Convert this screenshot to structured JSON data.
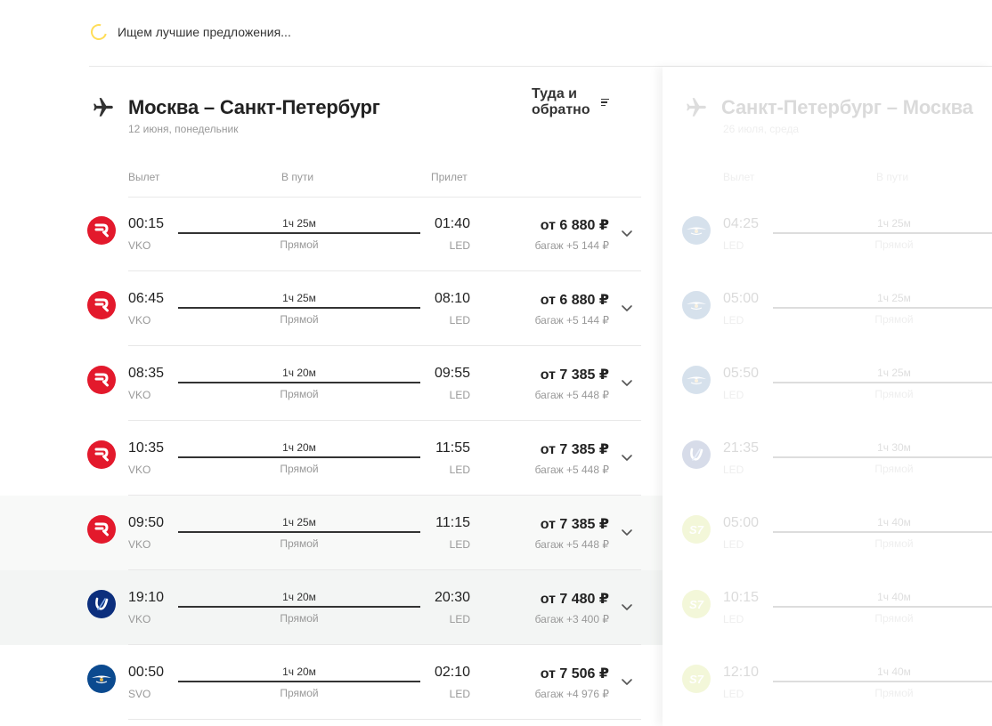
{
  "status": {
    "text": "Ищем лучшие предложения..."
  },
  "outbound": {
    "title": "Москва – Санкт-Петербург",
    "date": "12 июня, понедельник",
    "columns": {
      "departure": "Вылет",
      "duration": "В пути",
      "arrival": "Прилет",
      "price": "Туда и обратно"
    },
    "flights": [
      {
        "airline": "rossiya",
        "dep_time": "00:15",
        "dep_code": "VKO",
        "duration": "1ч 25м",
        "kind": "Прямой",
        "arr_time": "01:40",
        "arr_code": "LED",
        "price": "от 6 880 ₽",
        "baggage": "багаж +5 144 ₽"
      },
      {
        "airline": "rossiya",
        "dep_time": "06:45",
        "dep_code": "VKO",
        "duration": "1ч 25м",
        "kind": "Прямой",
        "arr_time": "08:10",
        "arr_code": "LED",
        "price": "от 6 880 ₽",
        "baggage": "багаж +5 144 ₽"
      },
      {
        "airline": "rossiya",
        "dep_time": "08:35",
        "dep_code": "VKO",
        "duration": "1ч 20м",
        "kind": "Прямой",
        "arr_time": "09:55",
        "arr_code": "LED",
        "price": "от 7 385 ₽",
        "baggage": "багаж +5 448 ₽"
      },
      {
        "airline": "rossiya",
        "dep_time": "10:35",
        "dep_code": "VKO",
        "duration": "1ч 20м",
        "kind": "Прямой",
        "arr_time": "11:55",
        "arr_code": "LED",
        "price": "от 7 385 ₽",
        "baggage": "багаж +5 448 ₽"
      },
      {
        "airline": "rossiya",
        "dep_time": "09:50",
        "dep_code": "VKO",
        "duration": "1ч 25м",
        "kind": "Прямой",
        "arr_time": "11:15",
        "arr_code": "LED",
        "price": "от 7 385 ₽",
        "baggage": "багаж +5 448 ₽"
      },
      {
        "airline": "utair",
        "dep_time": "19:10",
        "dep_code": "VKO",
        "duration": "1ч 20м",
        "kind": "Прямой",
        "arr_time": "20:30",
        "arr_code": "LED",
        "price": "от 7 480 ₽",
        "baggage": "багаж +3 400 ₽"
      },
      {
        "airline": "aeroflot",
        "dep_time": "00:50",
        "dep_code": "SVO",
        "duration": "1ч 20м",
        "kind": "Прямой",
        "arr_time": "02:10",
        "arr_code": "LED",
        "price": "от 7 506 ₽",
        "baggage": "багаж +4 976 ₽"
      }
    ]
  },
  "return": {
    "title": "Санкт-Петербург – Москва",
    "date": "26 июля, среда",
    "columns": {
      "departure": "Вылет",
      "duration": "В пути"
    },
    "flights": [
      {
        "airline": "aeroflot",
        "dep_time": "04:25",
        "dep_code": "LED",
        "duration": "1ч 25м",
        "kind": "Прямой"
      },
      {
        "airline": "aeroflot",
        "dep_time": "05:00",
        "dep_code": "LED",
        "duration": "1ч 25м",
        "kind": "Прямой"
      },
      {
        "airline": "aeroflot",
        "dep_time": "05:50",
        "dep_code": "LED",
        "duration": "1ч 25м",
        "kind": "Прямой"
      },
      {
        "airline": "utair",
        "dep_time": "21:35",
        "dep_code": "LED",
        "duration": "1ч 30м",
        "kind": "Прямой"
      },
      {
        "airline": "s7",
        "dep_time": "05:00",
        "dep_code": "LED",
        "duration": "1ч 40м",
        "kind": "Прямой"
      },
      {
        "airline": "s7",
        "dep_time": "10:15",
        "dep_code": "LED",
        "duration": "1ч 40м",
        "kind": "Прямой"
      },
      {
        "airline": "s7",
        "dep_time": "12:10",
        "dep_code": "LED",
        "duration": "1ч 40м",
        "kind": "Прямой"
      }
    ]
  },
  "icons": {
    "status": "loading-spinner-icon",
    "route": "plane-icon",
    "sort": "sort-icon",
    "expand": "chevron-down-icon"
  },
  "colors": {
    "rossiya": "#e3192c",
    "aeroflot": "#0b4a8f",
    "utair": "#0c2f7d",
    "s7": "#b7cf1a",
    "spinner": "#ffdd57"
  }
}
